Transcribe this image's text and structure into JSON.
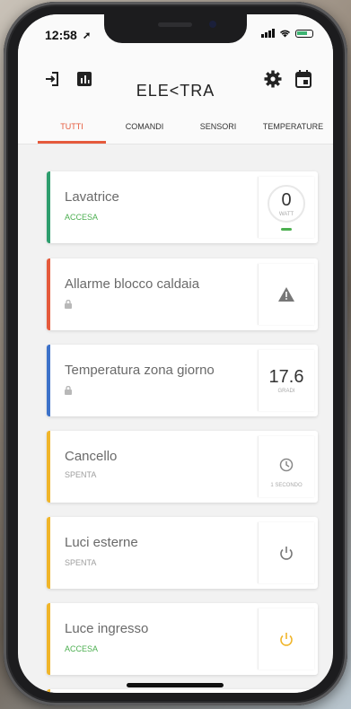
{
  "status": {
    "time": "12:58"
  },
  "header": {
    "logo": "ELE<TRA"
  },
  "tabs": [
    {
      "label": "TUTTI",
      "active": true
    },
    {
      "label": "COMANDI",
      "active": false
    },
    {
      "label": "SENSORI",
      "active": false
    },
    {
      "label": "TEMPERATURE",
      "active": false
    }
  ],
  "cards": [
    {
      "title": "Lavatrice",
      "status": "ACCESA",
      "value": "0",
      "unit": "WATT",
      "color": "#2e9e6e",
      "icon": "watt-gauge"
    },
    {
      "title": "Allarme blocco caldaia",
      "status": "",
      "color": "#e55a3c",
      "icon": "warning-icon"
    },
    {
      "title": "Temperatura zona giorno",
      "status": "",
      "value": "17.6",
      "unit": "GRADI",
      "color": "#3d72c9",
      "icon": "temperature-value"
    },
    {
      "title": "Cancello",
      "status": "SPENTA",
      "unit": "1 SECONDO",
      "color": "#f0b52a",
      "icon": "clock-icon"
    },
    {
      "title": "Luci esterne",
      "status": "SPENTA",
      "color": "#f0b52a",
      "icon": "power-icon"
    },
    {
      "title": "Luce ingresso",
      "status": "ACCESA",
      "color": "#f0b52a",
      "icon": "power-icon"
    }
  ],
  "colors": {
    "accent": "#e55a3c",
    "on": "#4caf50",
    "power_on": "#f0b52a",
    "power_off": "#777777"
  }
}
